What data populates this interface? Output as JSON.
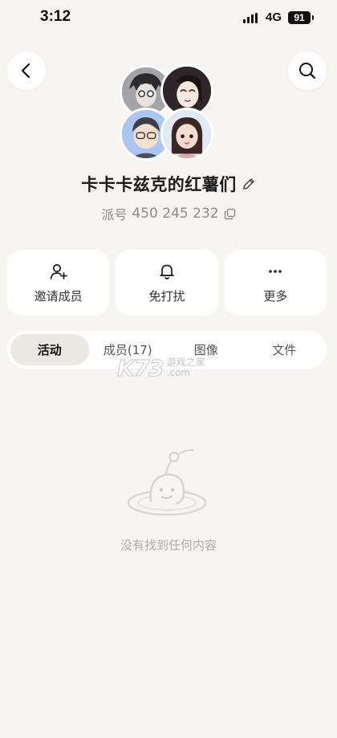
{
  "status_bar": {
    "time": "3:12",
    "network": "4G",
    "battery": "91"
  },
  "header": {
    "back_icon": "chevron-left-icon",
    "search_icon": "search-icon"
  },
  "group": {
    "name": "卡卡卡兹克的红薯们",
    "id_label": "派号",
    "id_number": "450 245 232"
  },
  "actions": [
    {
      "label": "邀请成员",
      "icon": "add-user-icon"
    },
    {
      "label": "免打扰",
      "icon": "bell-icon"
    },
    {
      "label": "更多",
      "icon": "more-icon"
    }
  ],
  "tabs": [
    {
      "label": "活动",
      "active": true
    },
    {
      "label": "成员(17)",
      "active": false
    },
    {
      "label": "图像",
      "active": false
    },
    {
      "label": "文件",
      "active": false
    }
  ],
  "watermark": {
    "logo": "K73",
    "line1": "游戏之家",
    "line2": ".com"
  },
  "empty_state": {
    "message": "没有找到任何内容"
  },
  "colors": {
    "background": "#f7f5f2",
    "card": "#ffffff",
    "active_tab": "#ebe7e3",
    "muted_text": "#b0aca8"
  }
}
